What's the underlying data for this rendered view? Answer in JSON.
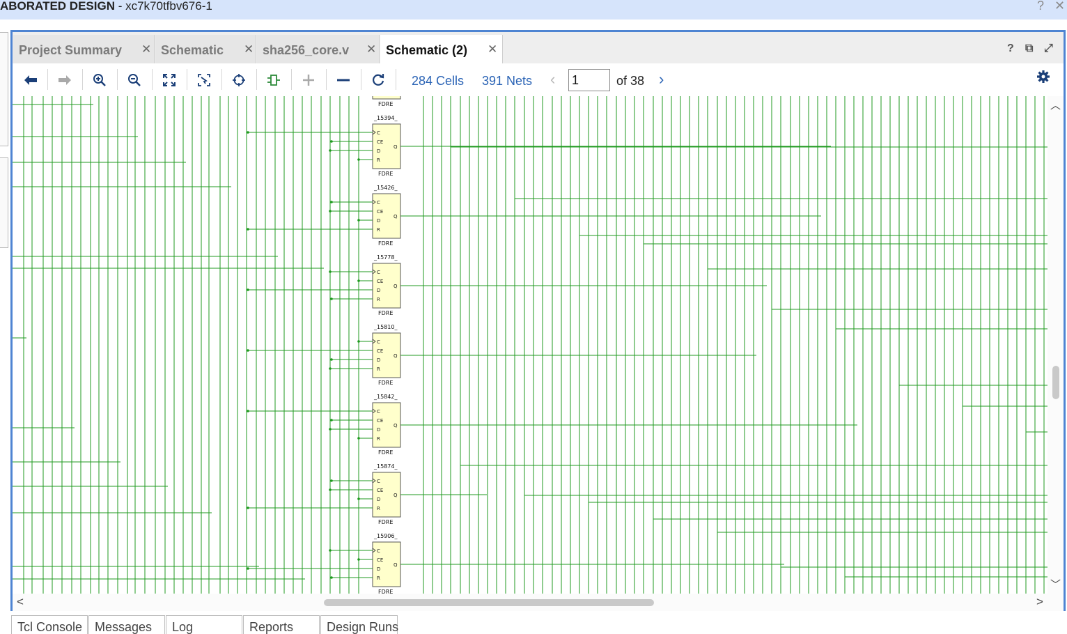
{
  "window": {
    "title_bold": "ABORATED DESIGN",
    "title_rest": " - xc7k70tfbv676-1",
    "help_glyph": "?",
    "close_glyph": "✕"
  },
  "tabs": [
    {
      "label": "Project Summary",
      "active": false
    },
    {
      "label": "Schematic",
      "active": false
    },
    {
      "label": "sha256_core.v",
      "active": false
    },
    {
      "label": "Schematic (2)",
      "active": true
    }
  ],
  "tab_close_glyph": "✕",
  "panel_icons": {
    "help": "?",
    "float": "⧉",
    "maximize": "⤢"
  },
  "toolbar": {
    "icons": [
      "back-arrow-icon",
      "forward-arrow-icon",
      "zoom-in-icon",
      "zoom-out-icon",
      "fit-view-icon",
      "zoom-selection-icon",
      "crosshair-icon",
      "cell-icon",
      "plus-icon",
      "minus-icon",
      "refresh-icon"
    ],
    "cells_label": "284 Cells",
    "nets_label": "391 Nets",
    "page_value": "1",
    "page_total": "of 38",
    "prev_glyph": "‹",
    "next_glyph": "›"
  },
  "schematic": {
    "wire_color": "#1f9a1f",
    "cell_fill": "#ffffcc",
    "cell_type": "FDRE",
    "pins_in": [
      "C",
      "CE",
      "D",
      "R"
    ],
    "pin_out": "Q",
    "cells": [
      "_15394_",
      "_15426_",
      "_15778_",
      "_15810_",
      "_15842_",
      "_15874_",
      "_15906_"
    ]
  },
  "bottom_tabs": [
    "Tcl Console",
    "Messages",
    "Log",
    "Reports",
    "Design Runs"
  ]
}
